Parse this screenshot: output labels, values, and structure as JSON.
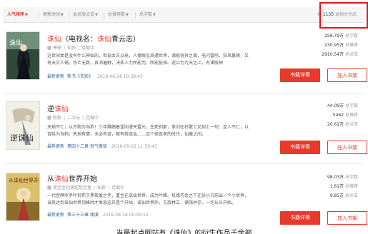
{
  "sort_tabs": [
    {
      "label": "人气排序",
      "active": true
    },
    {
      "label": "更新时间",
      "active": false
    },
    {
      "label": "会员周点击",
      "active": false
    },
    {
      "label": "总推荐数",
      "active": false
    },
    {
      "label": "总字数",
      "active": false
    }
  ],
  "result_count": {
    "prefix": "共",
    "count": "1135",
    "suffix": "本相关作品"
  },
  "books": [
    {
      "title_hl": "诛仙",
      "title_rest": "（电视名：",
      "title_hl2": "诛仙",
      "title_end": "青云志）",
      "author": "萧鼎",
      "category": "仙侠",
      "status": "连载中",
      "desc": "这世间本是没有什么神仙的，但自太古以来，人类眼见周遭世界，诸般奇异之事，电闪雷鸣，狂风暴雨，又有天灾人祸，伤亡无数，哀鸿遍野，决非人力所能为，所能抵挡。遂以为九天之上，有诸般神",
      "update_label": "最新更新",
      "update_chapter": "新书《天影》",
      "update_time": "2016-06-28 10:38:43",
      "stats": [
        {
          "num": "258.79万",
          "label": "总字数"
        },
        {
          "num": "230.95万",
          "label": "总推荐"
        },
        {
          "num": "2910.54万",
          "label": "总点击"
        }
      ],
      "cover_caption": "诛仙"
    },
    {
      "title_hl": "逆",
      "title_rest": "",
      "title_hl2": "诛仙",
      "title_end": "",
      "author": "粉粉",
      "category": "二次元",
      "status": "连载中",
      "desc": "天地不仁，以万物为刍狗！少年蹒跚着望向漫天雷光，生死刹那，拿剑在石壁上又刻上一句：圣人不仁，以百姓为刍狗；天地有情，未必有道，唯有修诛仙……这个修真者的时代，仙魔之间。",
      "update_label": "最新更新",
      "update_chapter": "第四十二章 但气傲徒",
      "update_time": "2016-05-03 11:50:43",
      "stats": [
        {
          "num": "44.09万",
          "label": "总字数"
        },
        {
          "num": "5462",
          "label": "总推荐"
        },
        {
          "num": "20.61万",
          "label": "总点击"
        }
      ],
      "cover_caption": "逆诛仙"
    },
    {
      "title_hl": "从",
      "title_rest": "",
      "title_hl2": "诛仙",
      "title_end": "世界开始",
      "author": "莲宝金创满超梨宝盒",
      "category": "仙侠",
      "status": "连载中",
      "desc": "一代金牌杀手叶封死于黑夜爱之手，重生在诛仙世界，成为叶峰。机缘巧合之下在张小凡前出一个小世界，当其达到诛仙世界顶峰时才发现这只是个开始，诛仙世界外，万族林立，诸强并存，一切从头开始。",
      "update_label": "最新更新",
      "update_chapter": "第三十三章 魂溪",
      "update_time": "2016-08-18 00:00:12",
      "stats": [
        {
          "num": "98.03万",
          "label": "总字数"
        },
        {
          "num": "1.61万",
          "label": "总推荐"
        },
        {
          "num": "9.85万",
          "label": "总点击"
        }
      ],
      "cover_caption": "从诛仙世界开始"
    }
  ],
  "buttons": {
    "detail": "书籍详情",
    "shelf": "加入书架"
  },
  "caption": "当最起点网站有《诛仙》的衍生作品千余部"
}
